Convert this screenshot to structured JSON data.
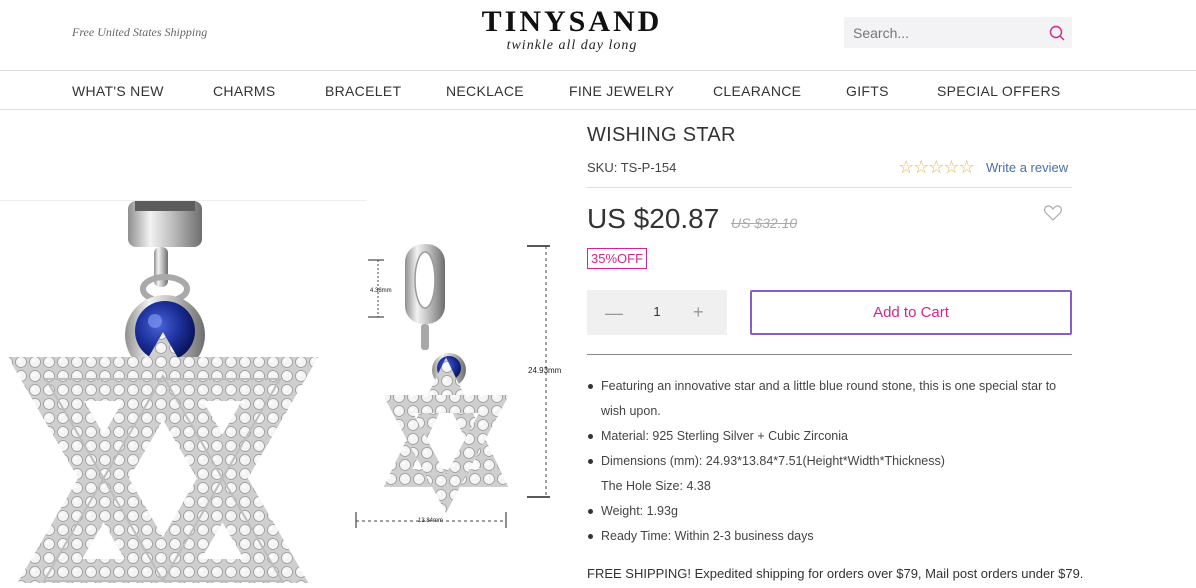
{
  "header": {
    "shipping_note": "Free United States Shipping",
    "brand_name": "TINYSAND",
    "brand_tagline": "twinkle all day long",
    "search_placeholder": "Search..."
  },
  "nav": {
    "items": [
      "WHAT'S NEW",
      "CHARMS",
      "BRACELET",
      "NECKLACE",
      "FINE JEWELRY",
      "CLEARANCE",
      "GIFTS",
      "SPECIAL OFFERS"
    ]
  },
  "spec_image": {
    "height_label": "24.93mm",
    "hole_label": "4.38mm",
    "width_label": "13.84mm"
  },
  "product": {
    "title": "WISHING STAR",
    "sku": "SKU: TS-P-154",
    "rating_stars": 0,
    "rating_max": 5,
    "review_link": "Write a review",
    "price": "US $20.87",
    "old_price": "US $32.10",
    "discount_badge": "35%OFF",
    "quantity": "1",
    "add_to_cart": "Add to Cart",
    "features": [
      "Featuring an innovative star and a little blue round stone, this is one special star to",
      "wish upon.",
      "Material: 925 Sterling Silver + Cubic Zirconia",
      "Dimensions (mm): 24.93*13.84*7.51(Height*Width*Thickness)",
      "The Hole Size: 4.38",
      "Weight: 1.93g",
      "Ready Time: Within 2-3 business days"
    ],
    "shipping_line": "FREE SHIPPING! Expedited shipping for orders over $79, Mail post orders under $79."
  },
  "colors": {
    "accent_pink": "#d0268f",
    "button_border": "#8a5cc7",
    "star_gold": "#e8b64c",
    "link_blue": "#4a6fa5"
  }
}
